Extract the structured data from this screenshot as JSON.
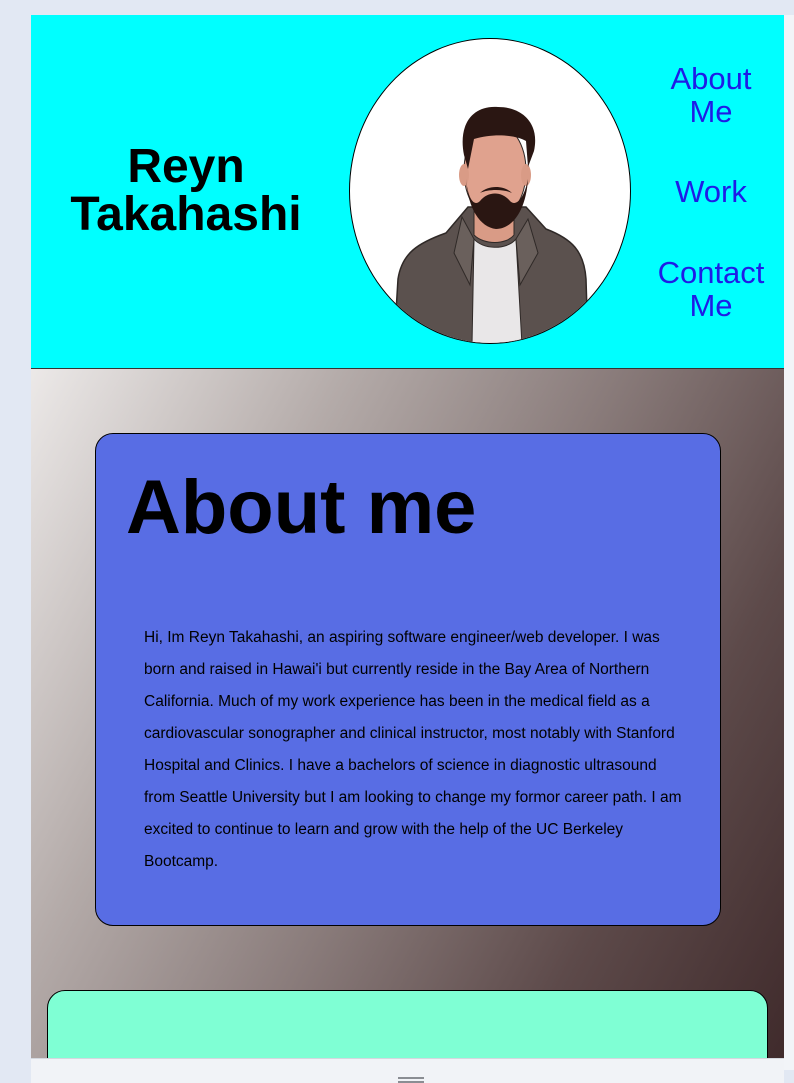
{
  "header": {
    "name": "Reyn Takahashi",
    "avatar_icon": "person-portrait-icon",
    "nav": {
      "about": "About Me",
      "work": "Work",
      "contact": "Contact Me"
    }
  },
  "about": {
    "title": "About me",
    "body": "Hi, Im Reyn Takahashi, an aspiring software engineer/web developer. I was born and raised in Hawai'i but currently reside in the Bay Area of Northern California. Much of my work experience has been in the medical field as a cardiovascular sonographer and clinical instructor, most notably with Stanford Hospital and Clinics. I have a bachelors of science in diagnostic ultrasound from Seattle University but I am looking to change my formor career path. I am excited to continue to learn and grow with the help of the UC Berkeley Bootcamp."
  },
  "colors": {
    "header_bg": "#00ffff",
    "nav_link": "#1f1ce6",
    "about_card": "#586de4",
    "work_card": "#7fffd4"
  }
}
